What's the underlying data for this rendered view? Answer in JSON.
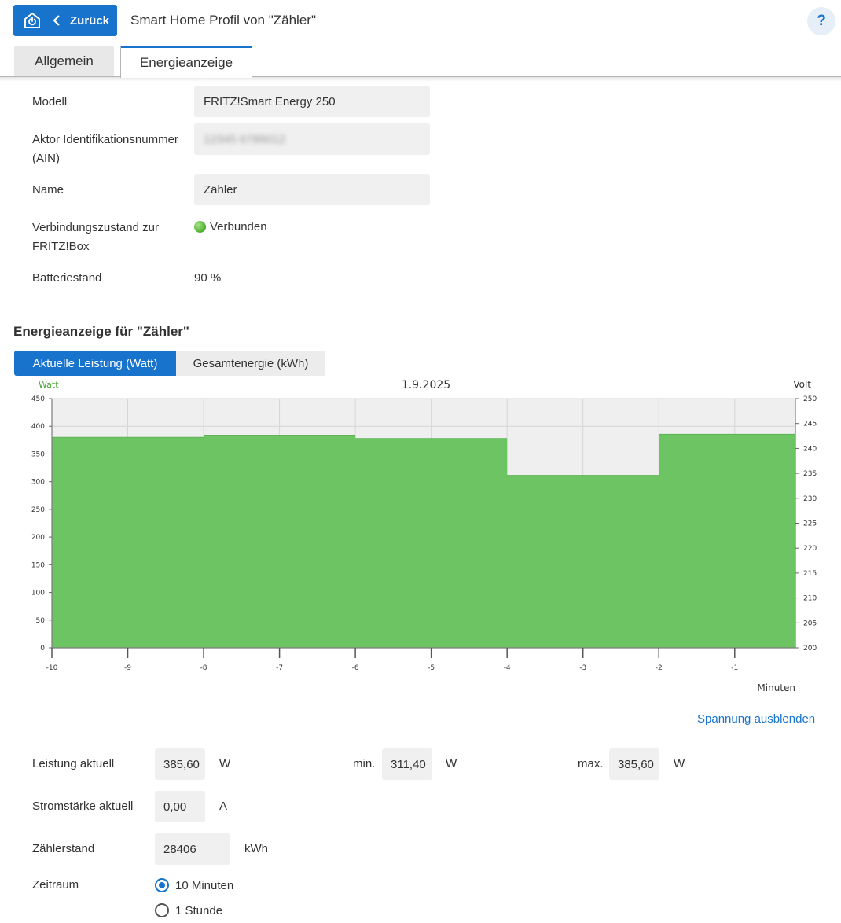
{
  "header": {
    "back_label": "Zurück",
    "title": "Smart Home Profil von \"Zähler\"",
    "help_label": "?"
  },
  "tabs": [
    {
      "label": "Allgemein",
      "active": false
    },
    {
      "label": "Energieanzeige",
      "active": true
    }
  ],
  "info": {
    "modell_label": "Modell",
    "modell_value": "FRITZ!Smart Energy 250",
    "ain_label_1": "Aktor Identifikationsnummer",
    "ain_label_2": "(AIN)",
    "ain_value": "12345 6789012",
    "name_label": "Name",
    "name_value": "Zähler",
    "conn_label_1": "Verbindungszustand zur",
    "conn_label_2": "FRITZ!Box",
    "conn_value": "Verbunden",
    "battery_label": "Batteriestand",
    "battery_value": "90 %"
  },
  "energy": {
    "section_title": "Energieanzeige für \"Zähler\"",
    "tab_power": "Aktuelle Leistung (Watt)",
    "tab_total": "Gesamtenergie (kWh)",
    "toggle_voltage": "Spannung ausblenden"
  },
  "chart_data": {
    "type": "area",
    "title": "1.9.2025",
    "ylabel": "Watt",
    "y2label": "Volt",
    "xlabel": "Minuten",
    "ylim": [
      0,
      450
    ],
    "y2lim": [
      200,
      250
    ],
    "yticks": [
      0,
      50,
      100,
      150,
      200,
      250,
      300,
      350,
      400,
      450
    ],
    "y2ticks": [
      200,
      205,
      210,
      215,
      220,
      225,
      230,
      235,
      240,
      245,
      250
    ],
    "xticks": [
      -10,
      -9,
      -8,
      -7,
      -6,
      -5,
      -4,
      -3,
      -2,
      -1
    ],
    "xlim": [
      -10,
      -0.2
    ],
    "grid": true,
    "color": "#6cc462",
    "series": [
      {
        "name": "Watt",
        "steps": [
          {
            "x0": -10,
            "x1": -8,
            "value": 380
          },
          {
            "x0": -8,
            "x1": -6,
            "value": 384
          },
          {
            "x0": -6,
            "x1": -4,
            "value": 378
          },
          {
            "x0": -4,
            "x1": -2,
            "value": 311.4
          },
          {
            "x0": -2,
            "x1": -0.2,
            "value": 385.6
          }
        ]
      }
    ]
  },
  "measurements": {
    "power_label": "Leistung aktuell",
    "power_value": "385,60",
    "power_unit": "W",
    "min_label": "min.",
    "min_value": "311,40",
    "min_unit": "W",
    "max_label": "max.",
    "max_value": "385,60",
    "max_unit": "W",
    "current_label": "Stromstärke aktuell",
    "current_value": "0,00",
    "current_unit": "A",
    "meter_label": "Zählerstand",
    "meter_value": "28406",
    "meter_unit": "kWh",
    "period_label": "Zeitraum",
    "period_options": [
      "10 Minuten",
      "1 Stunde"
    ],
    "period_selected": "10 Minuten"
  }
}
